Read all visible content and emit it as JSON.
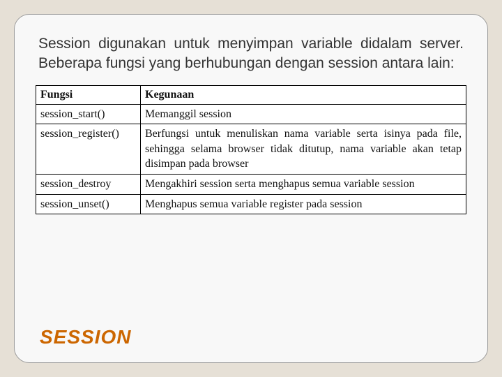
{
  "intro_text": "Session digunakan untuk menyimpan variable didalam server. Beberapa fungsi yang berhubungan dengan session antara lain:",
  "table": {
    "headers": {
      "col1": "Fungsi",
      "col2": "Kegunaan"
    },
    "rows": [
      {
        "fn": "session_start()",
        "desc": "Memanggil session"
      },
      {
        "fn": "session_register()",
        "desc": "Berfungsi untuk menuliskan nama variable serta isinya pada file, sehingga selama browser tidak ditutup, nama variable akan tetap disimpan pada browser"
      },
      {
        "fn": "session_destroy",
        "desc": "Mengakhiri session serta menghapus semua variable session"
      },
      {
        "fn": "session_unset()",
        "desc": "Menghapus semua variable register pada session"
      }
    ]
  },
  "title": "SESSION"
}
